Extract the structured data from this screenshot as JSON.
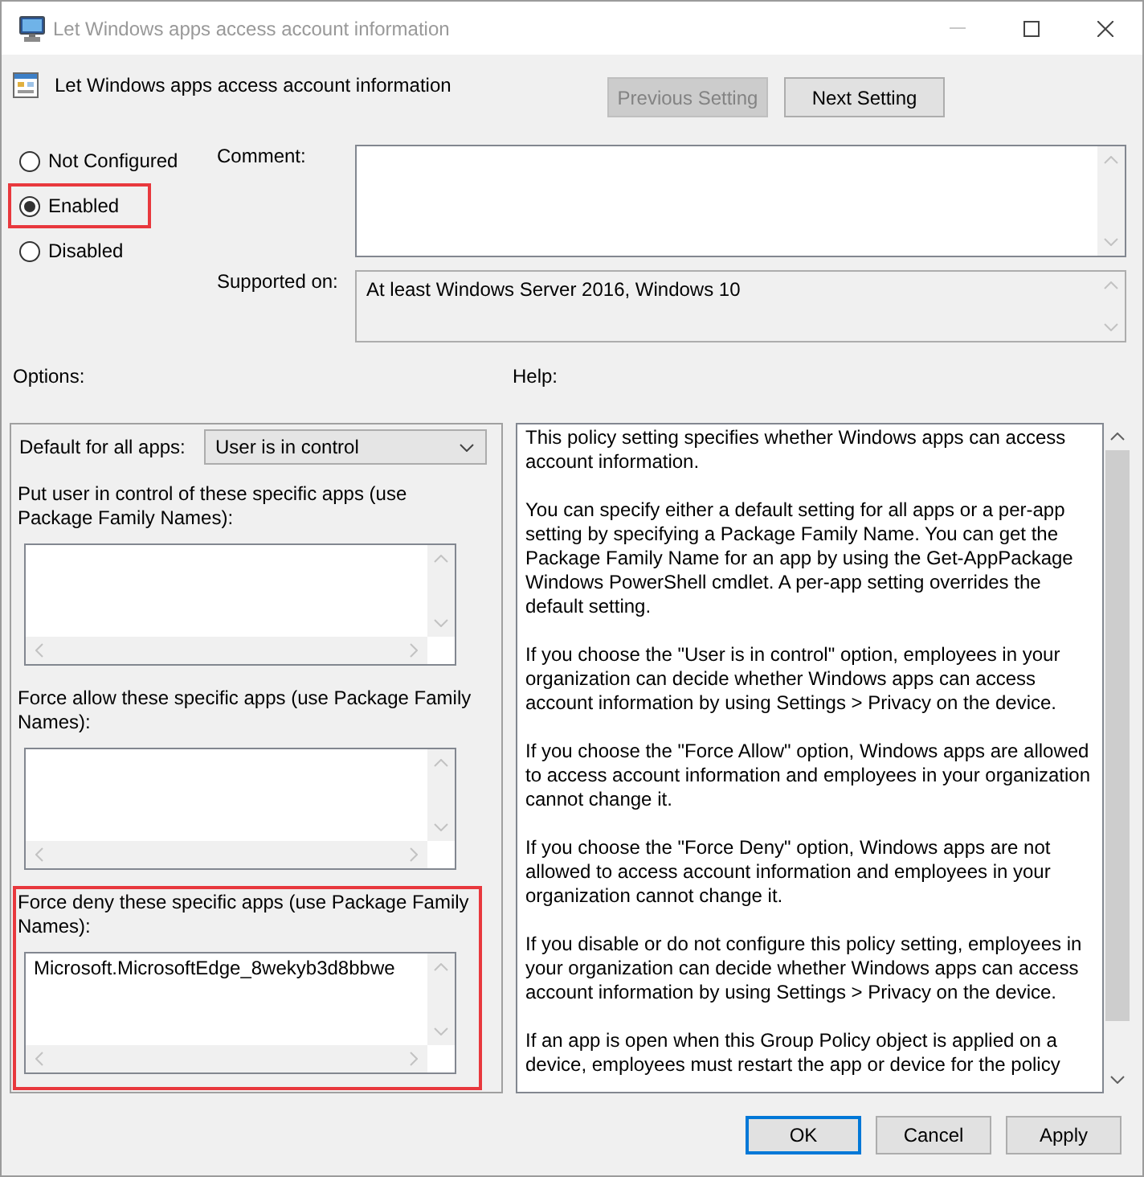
{
  "window": {
    "title": "Let Windows apps access account information"
  },
  "header": {
    "title": "Let Windows apps access account information",
    "buttons": [
      {
        "label": "Previous Setting",
        "disabled": true
      },
      {
        "label": "Next Setting",
        "disabled": false
      }
    ]
  },
  "state_options": [
    {
      "label": "Not Configured",
      "selected": false,
      "highlighted": false
    },
    {
      "label": "Enabled",
      "selected": true,
      "highlighted": true
    },
    {
      "label": "Disabled",
      "selected": false,
      "highlighted": false
    }
  ],
  "comment": {
    "label": "Comment:"
  },
  "supported_on": {
    "label": "Supported on:",
    "value": "At least Windows Server 2016, Windows 10"
  },
  "options": {
    "label": "Options:",
    "default_for_all_apps": {
      "label": "Default for all apps:",
      "value": "User is in control"
    },
    "app_lists": [
      {
        "label": "Put user in control of these specific apps (use Package Family Names):",
        "highlighted": false
      },
      {
        "label": "Force allow these specific apps (use Package Family Names):",
        "highlighted": false
      },
      {
        "label": "Force deny these specific apps (use Package Family Names):",
        "value": "Microsoft.MicrosoftEdge_8wekyb3d8bbwe",
        "highlighted": true
      }
    ]
  },
  "help": {
    "label": "Help:",
    "paragraphs": [
      "This policy setting specifies whether Windows apps can access account information.",
      "You can specify either a default setting for all apps or a per-app setting by specifying a Package Family Name. You can get the Package Family Name for an app by using the Get-AppPackage Windows PowerShell cmdlet. A per-app setting overrides the default setting.",
      "If you choose the \"User is in control\" option, employees in your organization can decide whether Windows apps can access account information by using Settings > Privacy on the device.",
      "If you choose the \"Force Allow\" option, Windows apps are allowed to access account information and employees in your organization cannot change it.",
      "If you choose the \"Force Deny\" option, Windows apps are not allowed to access account information and employees in your organization cannot change it.",
      "If you disable or do not configure this policy setting, employees in your organization can decide whether Windows apps can access account information by using Settings > Privacy on the device.",
      "If an app is open when this Group Policy object is applied on a device, employees must restart the app or device for the policy"
    ]
  },
  "buttons": [
    {
      "label": "OK",
      "default": true
    },
    {
      "label": "Cancel",
      "default": false
    },
    {
      "label": "Apply",
      "default": false
    }
  ]
}
